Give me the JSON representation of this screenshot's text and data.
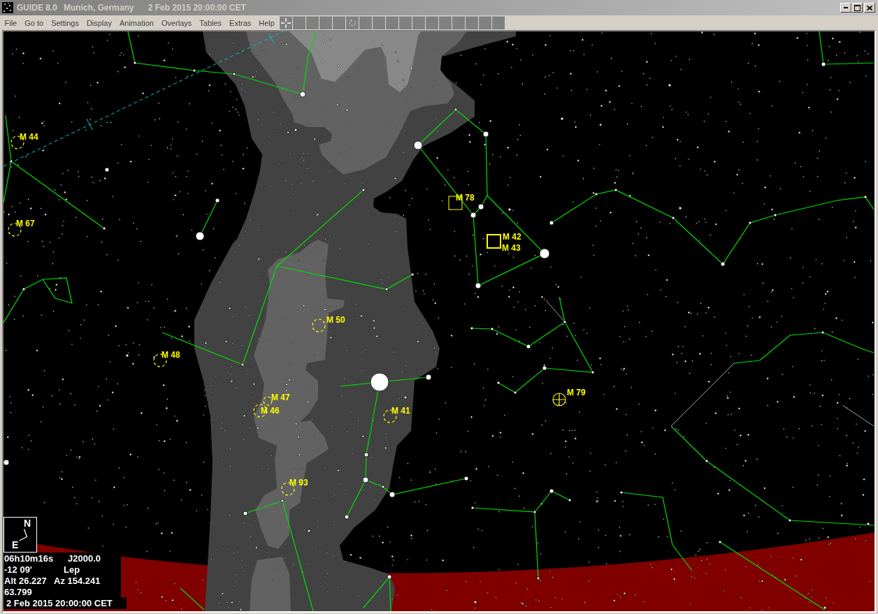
{
  "window": {
    "app_title": "GUIDE 8.0",
    "location": "Munich, Germany",
    "datetime": "2 Feb 2015 20:00:00 CET"
  },
  "menu": [
    "File",
    "Go to",
    "Settings",
    "Display",
    "Animation",
    "Overlays",
    "Tables",
    "Extras",
    "Help"
  ],
  "toolbar": [
    {
      "kind": "crosshair"
    },
    {
      "kind": "blank"
    },
    {
      "kind": "blank"
    },
    {
      "kind": "blank"
    },
    {
      "kind": "blank"
    },
    {
      "kind": "rotate"
    },
    {
      "kind": "blank"
    },
    {
      "kind": "blank"
    },
    {
      "kind": "blank"
    },
    {
      "kind": "blank"
    },
    {
      "kind": "blank"
    },
    {
      "kind": "blank"
    },
    {
      "kind": "blank"
    },
    {
      "kind": "blank"
    },
    {
      "kind": "blank"
    },
    {
      "kind": "blank"
    },
    {
      "kind": "blank"
    }
  ],
  "chart": {
    "deep_sky_objects": [
      {
        "label": "M 44",
        "kind": "open_cluster"
      },
      {
        "label": "M 67",
        "kind": "open_cluster"
      },
      {
        "label": "M 48",
        "kind": "open_cluster"
      },
      {
        "label": "M 50",
        "kind": "open_cluster"
      },
      {
        "label": "M 47",
        "kind": "open_cluster"
      },
      {
        "label": "M 46",
        "kind": "open_cluster"
      },
      {
        "label": "M 41",
        "kind": "open_cluster"
      },
      {
        "label": "M 93",
        "kind": "open_cluster"
      },
      {
        "label": "M 78",
        "kind": "nebula"
      },
      {
        "label": "M 42",
        "kind": "nebula"
      },
      {
        "label": "M 43",
        "kind": "label_only"
      },
      {
        "label": "M 79",
        "kind": "globular_cluster"
      }
    ]
  },
  "compass": {
    "north": "N",
    "east": "E"
  },
  "info": {
    "ra": "06h10m16s",
    "epoch": "J2000.0",
    "dec": "-12 09'",
    "constellation": "Lep",
    "alt": "Alt 26.227",
    "az": "Az 154.241",
    "field": "63.799",
    "datetime": "2 Feb 2015 20:00:00 CET"
  }
}
